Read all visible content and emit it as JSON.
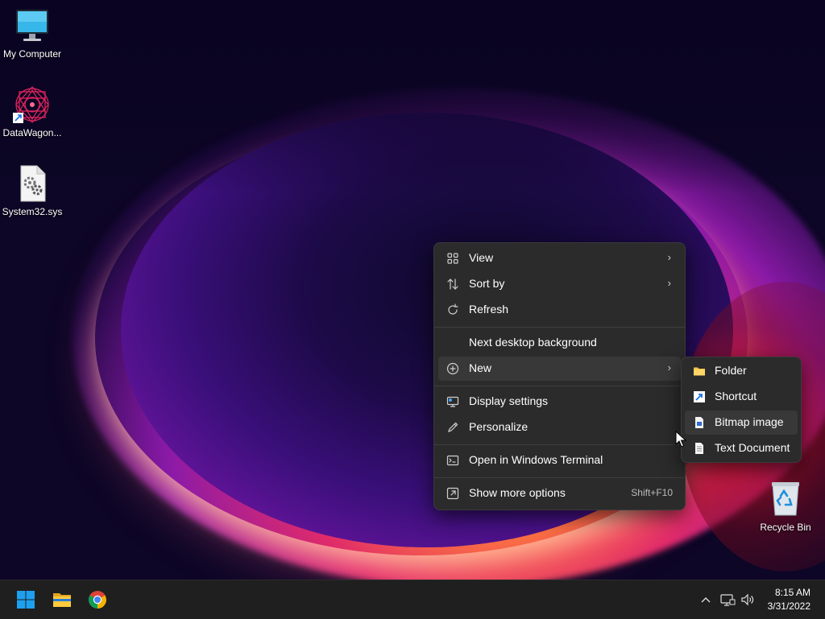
{
  "desktop": {
    "icons": [
      {
        "label": "My Computer",
        "icon": "monitor-icon"
      },
      {
        "label": "DataWagon...",
        "icon": "mandala-app-icon"
      },
      {
        "label": "System32.sys",
        "icon": "system-file-icon"
      },
      {
        "label": "Recycle Bin",
        "icon": "recycle-bin-icon"
      }
    ]
  },
  "context_menu": {
    "items": {
      "view": {
        "label": "View",
        "icon": "grid-icon"
      },
      "sort_by": {
        "label": "Sort by",
        "icon": "sort-arrows-icon"
      },
      "refresh": {
        "label": "Refresh",
        "icon": "refresh-icon"
      },
      "next_bg": {
        "label": "Next desktop background"
      },
      "new": {
        "label": "New",
        "icon": "plus-circle-icon"
      },
      "display": {
        "label": "Display settings",
        "icon": "display-icon"
      },
      "personalize": {
        "label": "Personalize",
        "icon": "pen-icon"
      },
      "terminal": {
        "label": "Open in Windows Terminal",
        "icon": "terminal-icon"
      },
      "more": {
        "label": "Show more options",
        "icon": "open-external-icon",
        "shortcut": "Shift+F10"
      }
    }
  },
  "submenu_new": {
    "items": [
      {
        "label": "Folder",
        "icon": "folder-icon"
      },
      {
        "label": "Shortcut",
        "icon": "shortcut-icon"
      },
      {
        "label": "Bitmap image",
        "icon": "bitmap-icon"
      },
      {
        "label": "Text Document",
        "icon": "text-document-icon"
      }
    ]
  },
  "taskbar": {
    "apps": [
      {
        "name": "Start",
        "icon": "windows-logo-icon"
      },
      {
        "name": "File Explorer",
        "icon": "folder-icon"
      },
      {
        "name": "Chrome",
        "icon": "chrome-icon"
      }
    ],
    "clock": {
      "time": "8:15 AM",
      "date": "3/31/2022"
    }
  },
  "colors": {
    "menu_bg": "#2b2b2b",
    "taskbar_bg": "#1f1f1f",
    "accent": "#0078d4"
  }
}
